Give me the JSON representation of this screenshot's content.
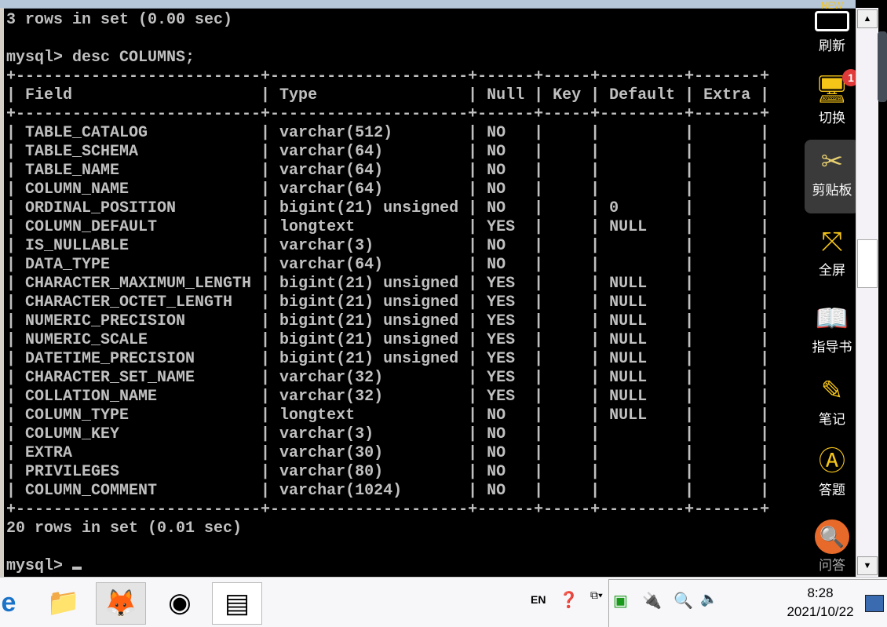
{
  "terminal": {
    "prev_result": "3 rows in set (0.00 sec)",
    "command": "mysql> desc COLUMNS;",
    "columns": [
      "Field",
      "Type",
      "Null",
      "Key",
      "Default",
      "Extra"
    ],
    "rows": [
      [
        "TABLE_CATALOG",
        "varchar(512)",
        "NO",
        "",
        "",
        ""
      ],
      [
        "TABLE_SCHEMA",
        "varchar(64)",
        "NO",
        "",
        "",
        ""
      ],
      [
        "TABLE_NAME",
        "varchar(64)",
        "NO",
        "",
        "",
        ""
      ],
      [
        "COLUMN_NAME",
        "varchar(64)",
        "NO",
        "",
        "",
        ""
      ],
      [
        "ORDINAL_POSITION",
        "bigint(21) unsigned",
        "NO",
        "",
        "0",
        ""
      ],
      [
        "COLUMN_DEFAULT",
        "longtext",
        "YES",
        "",
        "NULL",
        ""
      ],
      [
        "IS_NULLABLE",
        "varchar(3)",
        "NO",
        "",
        "",
        ""
      ],
      [
        "DATA_TYPE",
        "varchar(64)",
        "NO",
        "",
        "",
        ""
      ],
      [
        "CHARACTER_MAXIMUM_LENGTH",
        "bigint(21) unsigned",
        "YES",
        "",
        "NULL",
        ""
      ],
      [
        "CHARACTER_OCTET_LENGTH",
        "bigint(21) unsigned",
        "YES",
        "",
        "NULL",
        ""
      ],
      [
        "NUMERIC_PRECISION",
        "bigint(21) unsigned",
        "YES",
        "",
        "NULL",
        ""
      ],
      [
        "NUMERIC_SCALE",
        "bigint(21) unsigned",
        "YES",
        "",
        "NULL",
        ""
      ],
      [
        "DATETIME_PRECISION",
        "bigint(21) unsigned",
        "YES",
        "",
        "NULL",
        ""
      ],
      [
        "CHARACTER_SET_NAME",
        "varchar(32)",
        "YES",
        "",
        "NULL",
        ""
      ],
      [
        "COLLATION_NAME",
        "varchar(32)",
        "YES",
        "",
        "NULL",
        ""
      ],
      [
        "COLUMN_TYPE",
        "longtext",
        "NO",
        "",
        "NULL",
        ""
      ],
      [
        "COLUMN_KEY",
        "varchar(3)",
        "NO",
        "",
        "",
        ""
      ],
      [
        "EXTRA",
        "varchar(30)",
        "NO",
        "",
        "",
        ""
      ],
      [
        "PRIVILEGES",
        "varchar(80)",
        "NO",
        "",
        "",
        ""
      ],
      [
        "COLUMN_COMMENT",
        "varchar(1024)",
        "NO",
        "",
        "",
        ""
      ]
    ],
    "result": "20 rows in set (0.01 sec)",
    "prompt": "mysql> "
  },
  "sidebar": {
    "items": [
      {
        "label": "刷新",
        "icon": "refresh-new-icon",
        "badge": "NEW"
      },
      {
        "label": "切换",
        "icon": "switch-monitor-icon",
        "badge": "1"
      },
      {
        "label": "剪贴板",
        "icon": "scissors-icon"
      },
      {
        "label": "全屏",
        "icon": "fullscreen-icon"
      },
      {
        "label": "指导书",
        "icon": "book-icon"
      },
      {
        "label": "笔记",
        "icon": "pencil-icon"
      },
      {
        "label": "答题",
        "icon": "answer-icon"
      },
      {
        "label": "问答",
        "icon": "qa-search-icon"
      }
    ]
  },
  "taskbar": {
    "language": "EN",
    "time": "8:28",
    "date": "2021/10/22"
  }
}
